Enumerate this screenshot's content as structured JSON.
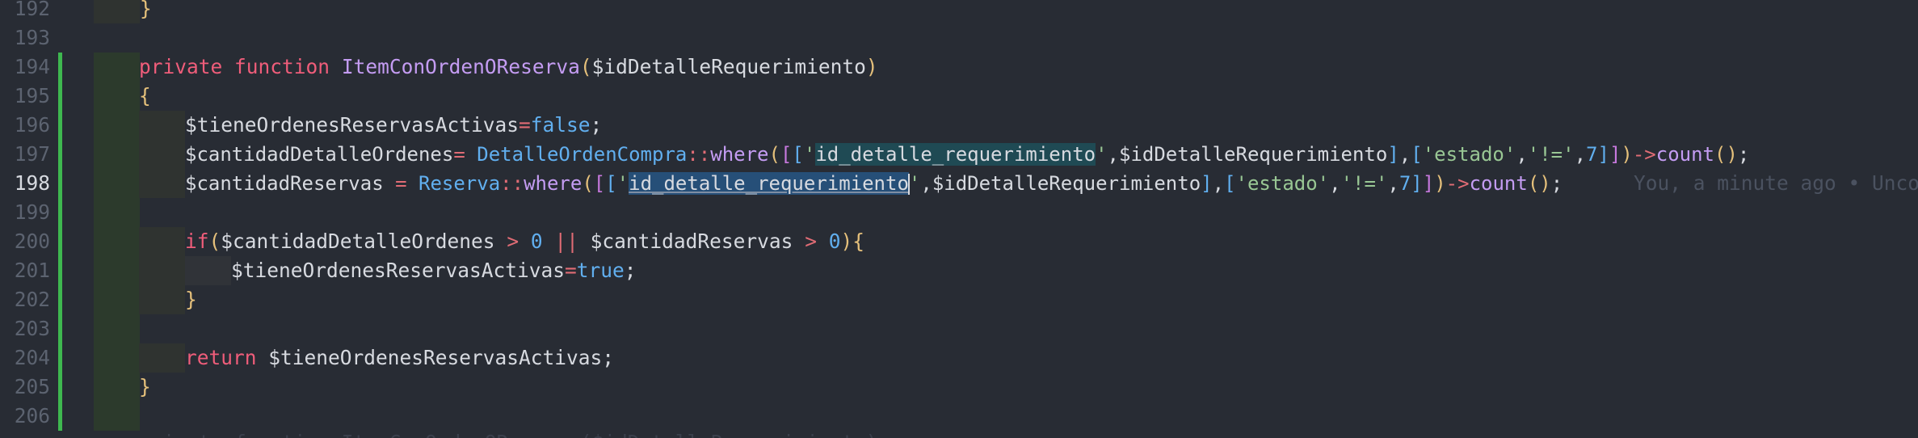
{
  "editor": {
    "lines": [
      {
        "num": "192",
        "text": "}"
      },
      {
        "num": "193",
        "text": ""
      },
      {
        "num": "194",
        "kw1": "private",
        "kw2": "function",
        "fn": "ItemConOrdenOReserva",
        "param": "$idDetalleRequerimiento"
      },
      {
        "num": "195",
        "text": "{"
      },
      {
        "num": "196",
        "var": "$tieneOrdenesReservasActivas",
        "val": "false"
      },
      {
        "num": "197",
        "var": "$cantidadDetalleOrdenes",
        "cls": "DetalleOrdenCompra",
        "method": "where",
        "field": "id_detalle_requerimiento",
        "param": "$idDetalleRequerimiento",
        "key2": "estado",
        "cmp": "!=",
        "n": "7",
        "call": "count"
      },
      {
        "num": "198",
        "var": "$cantidadReservas",
        "cls": "Reserva",
        "method": "where",
        "field": "id_detalle_requerimiento",
        "param": "$idDetalleRequerimiento",
        "key2": "estado",
        "cmp": "!=",
        "n": "7",
        "call": "count",
        "blame": "You, a minute ago • Unco"
      },
      {
        "num": "199",
        "text": ""
      },
      {
        "num": "200",
        "kw": "if",
        "a": "$cantidadDetalleOrdenes",
        "op1": ">",
        "zero": "0",
        "or": "||",
        "b": "$cantidadReservas"
      },
      {
        "num": "201",
        "var": "$tieneOrdenesReservasActivas",
        "val": "true"
      },
      {
        "num": "202",
        "text": "}"
      },
      {
        "num": "203",
        "text": ""
      },
      {
        "num": "204",
        "kw": "return",
        "var": "$tieneOrdenesReservasActivas"
      },
      {
        "num": "205",
        "text": "}"
      },
      {
        "num": "206",
        "text": ""
      }
    ],
    "next_line_hint": "private function ItemConOrdenOReserva($idDetalleRequerimiento)"
  }
}
